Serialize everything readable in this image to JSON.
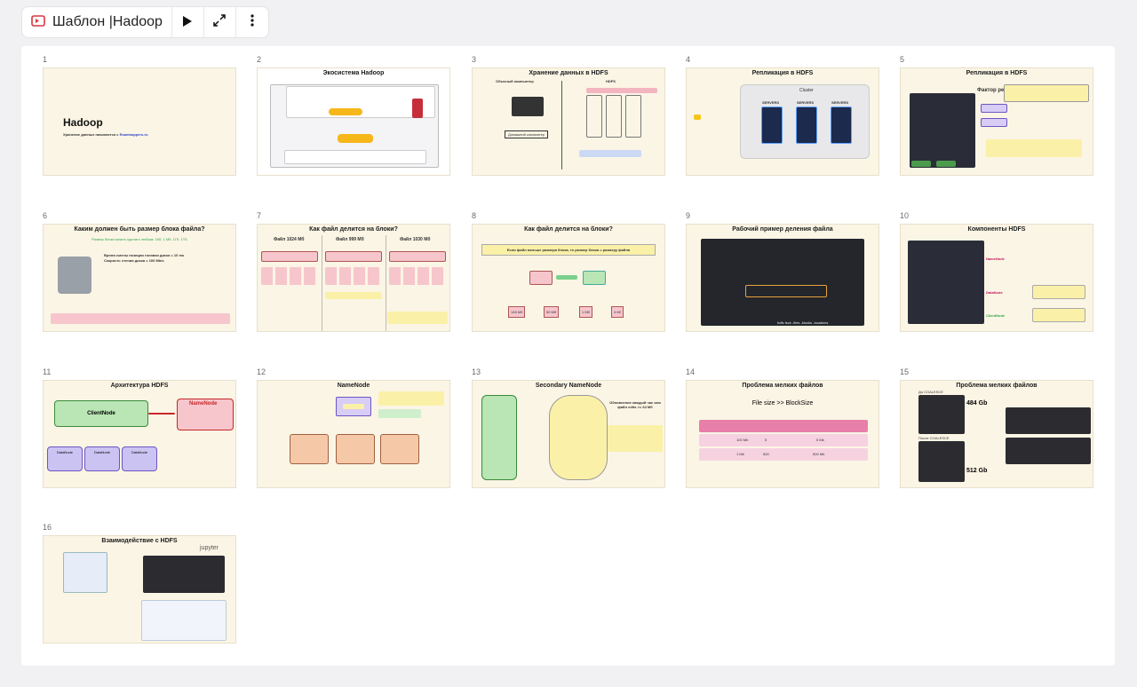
{
  "toolbar": {
    "title": "Шаблон |Hadoop",
    "icons": [
      "presentation-icon",
      "play-icon",
      "expand-icon",
      "more-vertical-icon"
    ]
  },
  "slides": [
    {
      "num": "1",
      "title": "Hadoop",
      "subtitle": "Хранение данных начинается с",
      "link": "Roadmappers.ru"
    },
    {
      "num": "2",
      "title": "Экосистема Hadoop"
    },
    {
      "num": "3",
      "title": "Хранение данных в HDFS",
      "left": "Обычный компьютер",
      "right": "HDFS",
      "caption": "Домашний компьютер"
    },
    {
      "num": "4",
      "title": "Репликация в HDFS",
      "cluster": "Cluster",
      "servers": [
        "SERVERS",
        "SERVERS",
        "SERVERS"
      ]
    },
    {
      "num": "5",
      "title": "Репликация в HDFS",
      "factor": "Фактор реп"
    },
    {
      "num": "6",
      "title": "Каким должен быть размер блока файла?",
      "line1": "Размер блока можно сделать любым: 1Кб, 1 Мб, 1Гб, 1ТБ",
      "line2": "Время смены позиции головки диска = 10 ms",
      "line3": "Скорость чтения диска = 100 Mb/s"
    },
    {
      "num": "7",
      "title": "Как файл делится на блоки?",
      "cols": [
        "Файл 1024 Мб",
        "Файл 999 Мб",
        "Файл 1030 Мб"
      ]
    },
    {
      "num": "8",
      "title": "Как файл делится на блоки?",
      "note": "Если файл меньше размера блока, то размер блока = размеру файла",
      "values": [
        "128 Мб",
        "50 Мб",
        "1 Мб",
        "4 Кб"
      ]
    },
    {
      "num": "9",
      "title": "Рабочий пример деления файла",
      "cmd": "hdfs fsck -files -blocks -locations"
    },
    {
      "num": "10",
      "title": "Компоненты HDFS",
      "labels": [
        "NameNode",
        "DataNode",
        "ClientNode"
      ]
    },
    {
      "num": "11",
      "title": "Архитектура HDFS",
      "client": "ClientNode",
      "namenode": "NameNode",
      "datanodes": [
        "DataNode",
        "DataNode",
        "DataNode"
      ]
    },
    {
      "num": "12",
      "title": "NameNode"
    },
    {
      "num": "13",
      "title": "Secondary NameNode",
      "note": "Обновление каждый час или файл edits >= 64 Мб"
    },
    {
      "num": "14",
      "title": "Проблема мелких файлов",
      "formula": "File size >> BlockSize",
      "rows": [
        [
          "100 Mb",
          "5",
          "5 Mb"
        ],
        [
          "1 Mb",
          "500",
          "500 Mb"
        ]
      ]
    },
    {
      "num": "15",
      "title": "Проблема мелких файлов",
      "before": "До COALESCE",
      "after": "После COALESCE",
      "size1": "484 Gb",
      "size2": "512 Gb"
    },
    {
      "num": "16",
      "title": "Взаимодействие с HDFS",
      "jupyter": "jupyter"
    }
  ],
  "colors": {
    "slide_bg": "#fbf5e5",
    "accent_red": "#d9363e",
    "node_green": "#b9e6b4",
    "node_purple": "#cbc3f2",
    "node_pink": "#f6c6cc"
  }
}
